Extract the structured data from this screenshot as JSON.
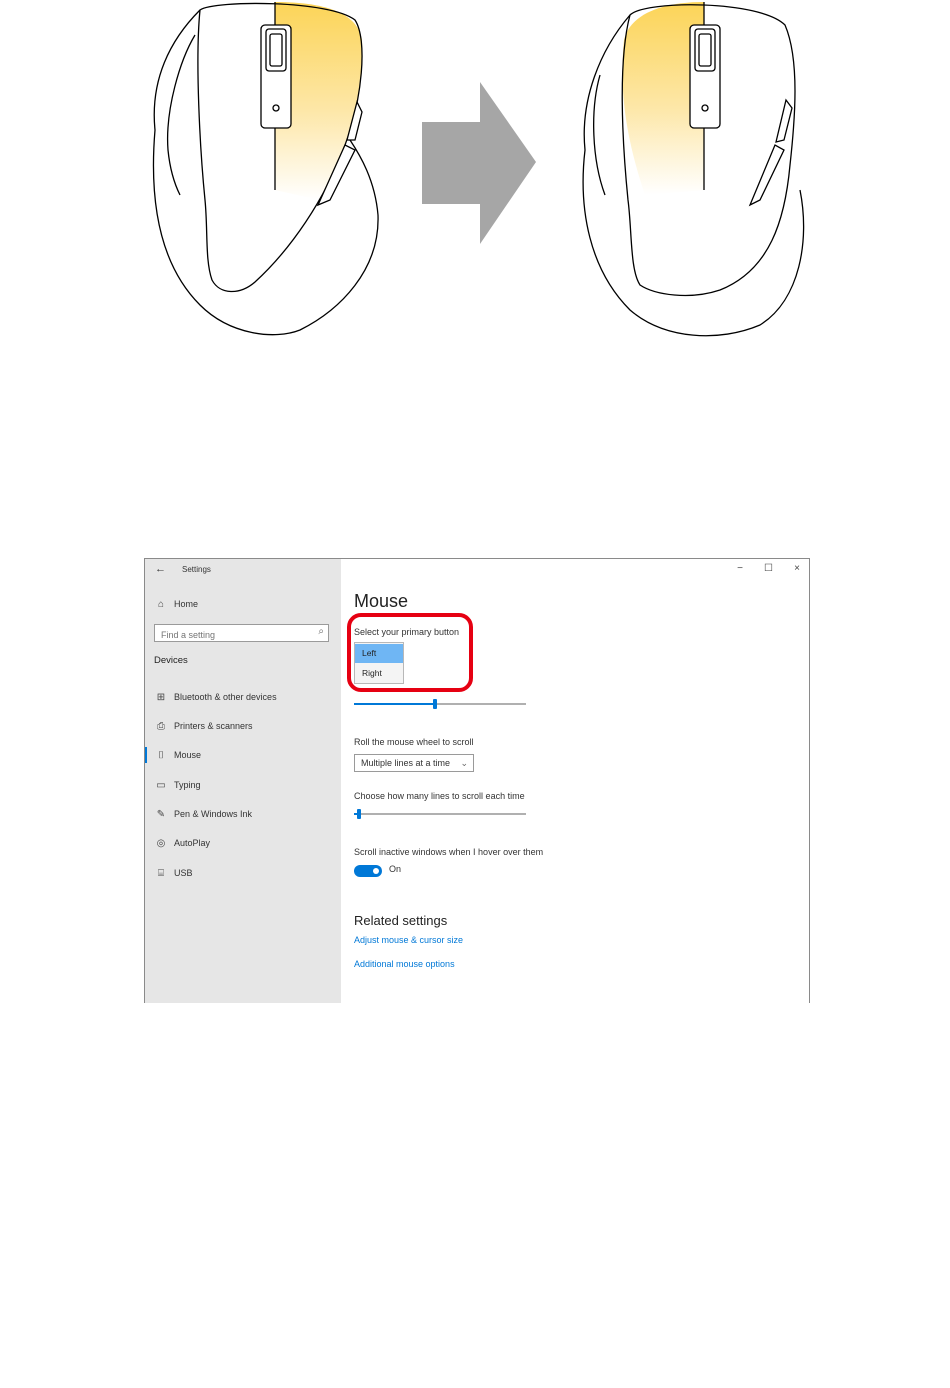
{
  "window": {
    "back_glyph": "←",
    "title": "Settings",
    "minimize_glyph": "−",
    "maximize_glyph": "☐",
    "close_glyph": "×"
  },
  "sidebar": {
    "home_label": "Home",
    "search_placeholder": "Find a setting",
    "search_icon_glyph": "⌕",
    "section_title": "Devices",
    "items": [
      {
        "label": "Bluetooth & other devices",
        "icon": "bluetooth-devices-icon",
        "glyph": "⊞"
      },
      {
        "label": "Printers & scanners",
        "icon": "printer-icon",
        "glyph": "⎙"
      },
      {
        "label": "Mouse",
        "icon": "mouse-icon",
        "glyph": "⌷",
        "active": true
      },
      {
        "label": "Typing",
        "icon": "keyboard-icon",
        "glyph": "▭"
      },
      {
        "label": "Pen & Windows Ink",
        "icon": "pen-icon",
        "glyph": "✎"
      },
      {
        "label": "AutoPlay",
        "icon": "autoplay-icon",
        "glyph": "◎"
      },
      {
        "label": "USB",
        "icon": "usb-icon",
        "glyph": "⌸"
      }
    ],
    "home_glyph": "⌂"
  },
  "main": {
    "title": "Mouse",
    "primary_button_label": "Select your primary button",
    "primary_button_options": [
      "Left",
      "Right"
    ],
    "primary_button_selected": "Left",
    "cursor_speed_level": 0.47,
    "wheel_label": "Roll the mouse wheel to scroll",
    "wheel_value": "Multiple lines at a time",
    "wheel_chevron": "⌄",
    "lines_label": "Choose how many lines to scroll each time",
    "lines_level": 0.02,
    "inactive_label": "Scroll inactive windows when I hover over them",
    "inactive_state": "On",
    "related_title": "Related settings",
    "link_cursor_size": "Adjust mouse & cursor size",
    "link_additional": "Additional mouse options"
  },
  "colors": {
    "accent": "#0078d7",
    "highlight_border": "#e60012",
    "selected_option": "#6fb6f4",
    "illustration_highlight": "#fcd457",
    "arrow": "#a6a6a6"
  }
}
